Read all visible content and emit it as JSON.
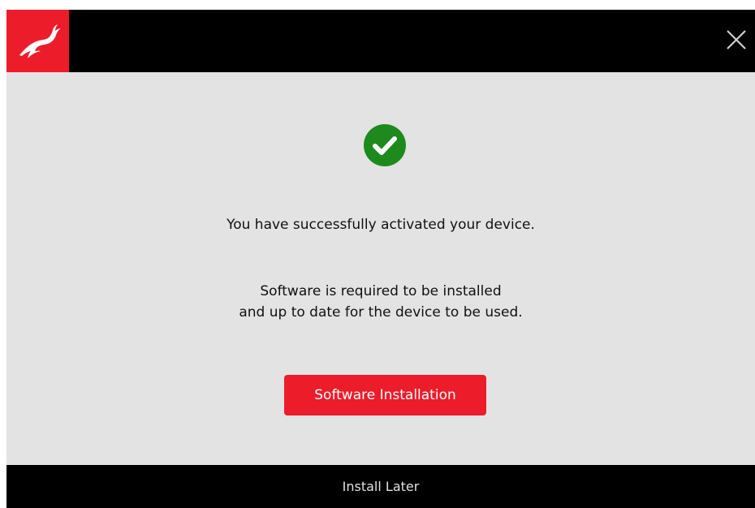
{
  "colors": {
    "accent": "#ec1c2a",
    "bar": "#000000",
    "background": "#e3e3e3",
    "success": "#1e8a1e"
  },
  "titlebar": {
    "logo_icon": "antelope-logo-icon",
    "close_icon": "close-icon"
  },
  "main": {
    "status_icon": "check-circle-icon",
    "success_message": "You have successfully activated your device.",
    "requirement_line1": "Software is required to be installed",
    "requirement_line2": "and up to date for the device to be used.",
    "install_button_label": "Software Installation"
  },
  "footer": {
    "install_later_label": "Install Later"
  }
}
